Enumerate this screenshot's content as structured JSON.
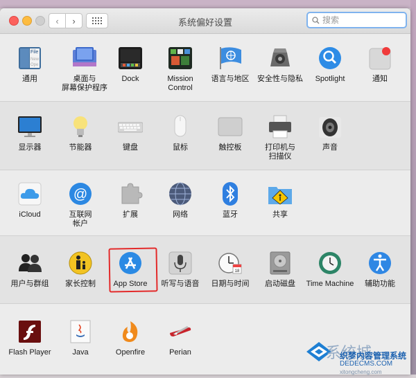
{
  "window": {
    "title": "系统偏好设置",
    "search_placeholder": "搜索"
  },
  "sections": [
    {
      "name": "personal",
      "panes": [
        {
          "label": "通用",
          "icon": "general-icon"
        },
        {
          "label": "桌面与\n屏幕保护程序",
          "icon": "desktop-icon"
        },
        {
          "label": "Dock",
          "icon": "dock-icon"
        },
        {
          "label": "Mission\nControl",
          "icon": "mission-control-icon"
        },
        {
          "label": "语言与地区",
          "icon": "language-region-icon"
        },
        {
          "label": "安全性与隐私",
          "icon": "security-privacy-icon"
        },
        {
          "label": "Spotlight",
          "icon": "spotlight-icon"
        },
        {
          "label": "通知",
          "icon": "notifications-icon"
        }
      ]
    },
    {
      "name": "hardware",
      "panes": [
        {
          "label": "显示器",
          "icon": "displays-icon"
        },
        {
          "label": "节能器",
          "icon": "energy-saver-icon"
        },
        {
          "label": "键盘",
          "icon": "keyboard-icon"
        },
        {
          "label": "鼠标",
          "icon": "mouse-icon"
        },
        {
          "label": "触控板",
          "icon": "trackpad-icon"
        },
        {
          "label": "打印机与\n扫描仪",
          "icon": "printer-icon"
        },
        {
          "label": "声音",
          "icon": "sound-icon"
        }
      ]
    },
    {
      "name": "internet",
      "panes": [
        {
          "label": "iCloud",
          "icon": "icloud-icon"
        },
        {
          "label": "互联网\n帐户",
          "icon": "internet-accounts-icon"
        },
        {
          "label": "扩展",
          "icon": "extensions-icon"
        },
        {
          "label": "网络",
          "icon": "network-icon"
        },
        {
          "label": "蓝牙",
          "icon": "bluetooth-icon"
        },
        {
          "label": "共享",
          "icon": "sharing-icon"
        }
      ]
    },
    {
      "name": "system",
      "panes": [
        {
          "label": "用户与群组",
          "icon": "users-groups-icon"
        },
        {
          "label": "家长控制",
          "icon": "parental-controls-icon"
        },
        {
          "label": "App Store",
          "icon": "app-store-icon"
        },
        {
          "label": "听写与语音",
          "icon": "dictation-speech-icon"
        },
        {
          "label": "日期与时间",
          "icon": "date-time-icon"
        },
        {
          "label": "启动磁盘",
          "icon": "startup-disk-icon"
        },
        {
          "label": "Time Machine",
          "icon": "time-machine-icon"
        },
        {
          "label": "辅助功能",
          "icon": "accessibility-icon"
        }
      ]
    },
    {
      "name": "other",
      "panes": [
        {
          "label": "Flash Player",
          "icon": "flash-player-icon"
        },
        {
          "label": "Java",
          "icon": "java-icon"
        },
        {
          "label": "Openfire",
          "icon": "openfire-icon"
        },
        {
          "label": "Perian",
          "icon": "perian-icon"
        }
      ]
    }
  ],
  "watermark": {
    "title": "系统城",
    "line1": "织梦内容管理系统",
    "line2": "DEDECMS.COM",
    "line3": "xitongcheng.com"
  },
  "colors": {
    "search_focus": "#7fb3ee",
    "highlight": "#e32a2a"
  }
}
